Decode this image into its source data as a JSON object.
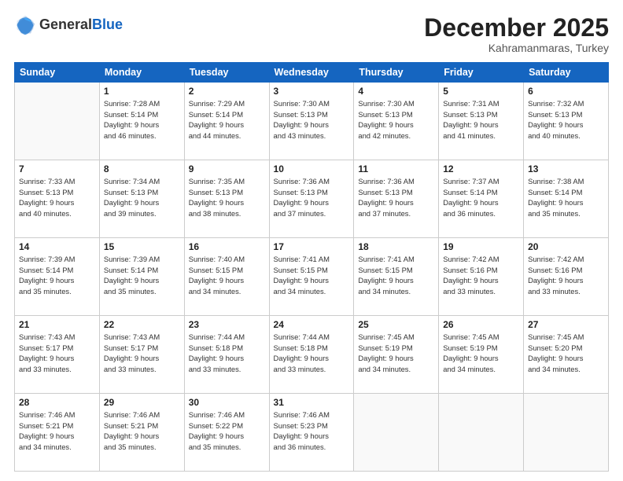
{
  "header": {
    "logo_line1": "General",
    "logo_line2": "Blue",
    "month": "December 2025",
    "location": "Kahramanmaras, Turkey"
  },
  "days_of_week": [
    "Sunday",
    "Monday",
    "Tuesday",
    "Wednesday",
    "Thursday",
    "Friday",
    "Saturday"
  ],
  "weeks": [
    [
      {
        "day": "",
        "info": ""
      },
      {
        "day": "1",
        "info": "Sunrise: 7:28 AM\nSunset: 5:14 PM\nDaylight: 9 hours\nand 46 minutes."
      },
      {
        "day": "2",
        "info": "Sunrise: 7:29 AM\nSunset: 5:14 PM\nDaylight: 9 hours\nand 44 minutes."
      },
      {
        "day": "3",
        "info": "Sunrise: 7:30 AM\nSunset: 5:13 PM\nDaylight: 9 hours\nand 43 minutes."
      },
      {
        "day": "4",
        "info": "Sunrise: 7:30 AM\nSunset: 5:13 PM\nDaylight: 9 hours\nand 42 minutes."
      },
      {
        "day": "5",
        "info": "Sunrise: 7:31 AM\nSunset: 5:13 PM\nDaylight: 9 hours\nand 41 minutes."
      },
      {
        "day": "6",
        "info": "Sunrise: 7:32 AM\nSunset: 5:13 PM\nDaylight: 9 hours\nand 40 minutes."
      }
    ],
    [
      {
        "day": "7",
        "info": "Sunrise: 7:33 AM\nSunset: 5:13 PM\nDaylight: 9 hours\nand 40 minutes."
      },
      {
        "day": "8",
        "info": "Sunrise: 7:34 AM\nSunset: 5:13 PM\nDaylight: 9 hours\nand 39 minutes."
      },
      {
        "day": "9",
        "info": "Sunrise: 7:35 AM\nSunset: 5:13 PM\nDaylight: 9 hours\nand 38 minutes."
      },
      {
        "day": "10",
        "info": "Sunrise: 7:36 AM\nSunset: 5:13 PM\nDaylight: 9 hours\nand 37 minutes."
      },
      {
        "day": "11",
        "info": "Sunrise: 7:36 AM\nSunset: 5:13 PM\nDaylight: 9 hours\nand 37 minutes."
      },
      {
        "day": "12",
        "info": "Sunrise: 7:37 AM\nSunset: 5:14 PM\nDaylight: 9 hours\nand 36 minutes."
      },
      {
        "day": "13",
        "info": "Sunrise: 7:38 AM\nSunset: 5:14 PM\nDaylight: 9 hours\nand 35 minutes."
      }
    ],
    [
      {
        "day": "14",
        "info": "Sunrise: 7:39 AM\nSunset: 5:14 PM\nDaylight: 9 hours\nand 35 minutes."
      },
      {
        "day": "15",
        "info": "Sunrise: 7:39 AM\nSunset: 5:14 PM\nDaylight: 9 hours\nand 35 minutes."
      },
      {
        "day": "16",
        "info": "Sunrise: 7:40 AM\nSunset: 5:15 PM\nDaylight: 9 hours\nand 34 minutes."
      },
      {
        "day": "17",
        "info": "Sunrise: 7:41 AM\nSunset: 5:15 PM\nDaylight: 9 hours\nand 34 minutes."
      },
      {
        "day": "18",
        "info": "Sunrise: 7:41 AM\nSunset: 5:15 PM\nDaylight: 9 hours\nand 34 minutes."
      },
      {
        "day": "19",
        "info": "Sunrise: 7:42 AM\nSunset: 5:16 PM\nDaylight: 9 hours\nand 33 minutes."
      },
      {
        "day": "20",
        "info": "Sunrise: 7:42 AM\nSunset: 5:16 PM\nDaylight: 9 hours\nand 33 minutes."
      }
    ],
    [
      {
        "day": "21",
        "info": "Sunrise: 7:43 AM\nSunset: 5:17 PM\nDaylight: 9 hours\nand 33 minutes."
      },
      {
        "day": "22",
        "info": "Sunrise: 7:43 AM\nSunset: 5:17 PM\nDaylight: 9 hours\nand 33 minutes."
      },
      {
        "day": "23",
        "info": "Sunrise: 7:44 AM\nSunset: 5:18 PM\nDaylight: 9 hours\nand 33 minutes."
      },
      {
        "day": "24",
        "info": "Sunrise: 7:44 AM\nSunset: 5:18 PM\nDaylight: 9 hours\nand 33 minutes."
      },
      {
        "day": "25",
        "info": "Sunrise: 7:45 AM\nSunset: 5:19 PM\nDaylight: 9 hours\nand 34 minutes."
      },
      {
        "day": "26",
        "info": "Sunrise: 7:45 AM\nSunset: 5:19 PM\nDaylight: 9 hours\nand 34 minutes."
      },
      {
        "day": "27",
        "info": "Sunrise: 7:45 AM\nSunset: 5:20 PM\nDaylight: 9 hours\nand 34 minutes."
      }
    ],
    [
      {
        "day": "28",
        "info": "Sunrise: 7:46 AM\nSunset: 5:21 PM\nDaylight: 9 hours\nand 34 minutes."
      },
      {
        "day": "29",
        "info": "Sunrise: 7:46 AM\nSunset: 5:21 PM\nDaylight: 9 hours\nand 35 minutes."
      },
      {
        "day": "30",
        "info": "Sunrise: 7:46 AM\nSunset: 5:22 PM\nDaylight: 9 hours\nand 35 minutes."
      },
      {
        "day": "31",
        "info": "Sunrise: 7:46 AM\nSunset: 5:23 PM\nDaylight: 9 hours\nand 36 minutes."
      },
      {
        "day": "",
        "info": ""
      },
      {
        "day": "",
        "info": ""
      },
      {
        "day": "",
        "info": ""
      }
    ]
  ]
}
